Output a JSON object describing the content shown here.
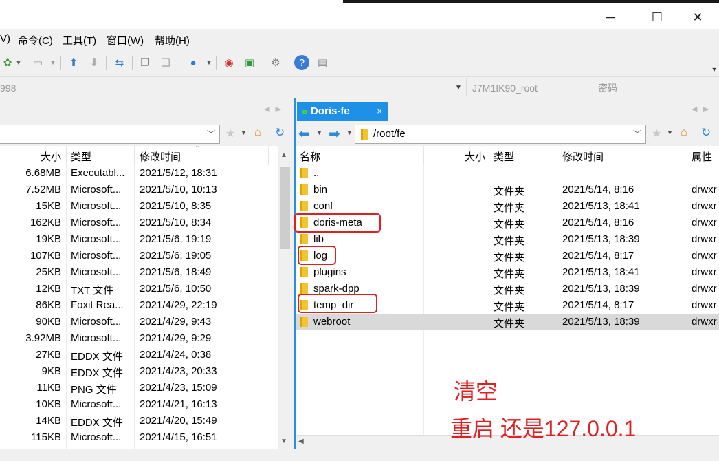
{
  "menu": [
    "命令(C)",
    "工具(T)",
    "窗口(W)",
    "帮助(H)"
  ],
  "menu_partial": "V)",
  "session": {
    "host_partial": "998",
    "user": "J7M1IK90_root",
    "password_placeholder": "密码"
  },
  "right_tab": {
    "label": "Doris-fe",
    "close": "×"
  },
  "left_pane": {
    "columns": [
      "大小",
      "类型",
      "修改时间"
    ],
    "rows": [
      {
        "size": "6.68MB",
        "type": "Executabl...",
        "mtime": "2021/5/12, 18:31"
      },
      {
        "size": "7.52MB",
        "type": "Microsoft...",
        "mtime": "2021/5/10, 10:13"
      },
      {
        "size": "15KB",
        "type": "Microsoft...",
        "mtime": "2021/5/10, 8:35"
      },
      {
        "size": "162KB",
        "type": "Microsoft...",
        "mtime": "2021/5/10, 8:34"
      },
      {
        "size": "19KB",
        "type": "Microsoft...",
        "mtime": "2021/5/6, 19:19"
      },
      {
        "size": "107KB",
        "type": "Microsoft...",
        "mtime": "2021/5/6, 19:05"
      },
      {
        "size": "25KB",
        "type": "Microsoft...",
        "mtime": "2021/5/6, 18:49"
      },
      {
        "size": "12KB",
        "type": "TXT 文件",
        "mtime": "2021/5/6, 10:50"
      },
      {
        "size": "86KB",
        "type": "Foxit Rea...",
        "mtime": "2021/4/29, 22:19"
      },
      {
        "size": "90KB",
        "type": "Microsoft...",
        "mtime": "2021/4/29, 9:43"
      },
      {
        "size": "3.92MB",
        "type": "Microsoft...",
        "mtime": "2021/4/29, 9:29"
      },
      {
        "size": "27KB",
        "type": "EDDX 文件",
        "mtime": "2021/4/24, 0:38"
      },
      {
        "size": "9KB",
        "type": "EDDX 文件",
        "mtime": "2021/4/23, 20:33"
      },
      {
        "size": "11KB",
        "type": "PNG 文件",
        "mtime": "2021/4/23, 15:09"
      },
      {
        "size": "10KB",
        "type": "Microsoft...",
        "mtime": "2021/4/21, 16:13"
      },
      {
        "size": "14KB",
        "type": "EDDX 文件",
        "mtime": "2021/4/20, 15:49"
      },
      {
        "size": "115KB",
        "type": "Microsoft...",
        "mtime": "2021/4/15, 16:51"
      }
    ]
  },
  "right_pane": {
    "path": "/root/fe",
    "columns": [
      "名称",
      "大小",
      "类型",
      "修改时间",
      "属性"
    ],
    "rows": [
      {
        "name": "..",
        "type": "",
        "mtime": "",
        "attr": ""
      },
      {
        "name": "bin",
        "type": "文件夹",
        "mtime": "2021/5/14, 8:16",
        "attr": "drwxr"
      },
      {
        "name": "conf",
        "type": "文件夹",
        "mtime": "2021/5/13, 18:41",
        "attr": "drwxr"
      },
      {
        "name": "doris-meta",
        "type": "文件夹",
        "mtime": "2021/5/14, 8:16",
        "attr": "drwxr"
      },
      {
        "name": "lib",
        "type": "文件夹",
        "mtime": "2021/5/13, 18:39",
        "attr": "drwxr"
      },
      {
        "name": "log",
        "type": "文件夹",
        "mtime": "2021/5/14, 8:17",
        "attr": "drwxr"
      },
      {
        "name": "plugins",
        "type": "文件夹",
        "mtime": "2021/5/13, 18:41",
        "attr": "drwxr"
      },
      {
        "name": "spark-dpp",
        "type": "文件夹",
        "mtime": "2021/5/13, 18:39",
        "attr": "drwxr"
      },
      {
        "name": "temp_dir",
        "type": "文件夹",
        "mtime": "2021/5/14, 8:17",
        "attr": "drwxr"
      },
      {
        "name": "webroot",
        "type": "文件夹",
        "mtime": "2021/5/13, 18:39",
        "attr": "drwxr",
        "selected": true
      }
    ]
  },
  "annotation": {
    "line1": "清空",
    "line2": "重启 还是127.0.0.1",
    "color": "#e02020"
  },
  "accent": "#1e90e8"
}
